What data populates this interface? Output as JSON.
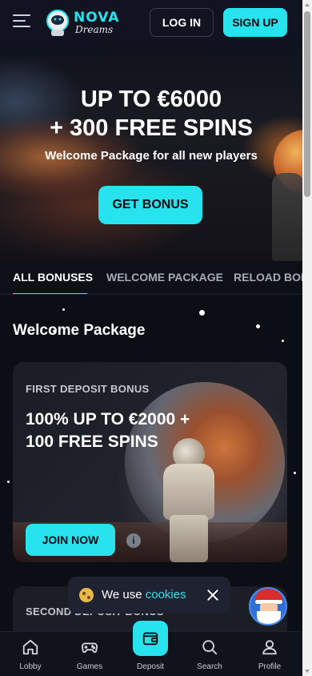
{
  "header": {
    "login_label": "LOG IN",
    "signup_label": "SIGN UP",
    "logo_main": "NOVA",
    "logo_sub": "Dreams"
  },
  "hero": {
    "title_line1": "UP TO €6000",
    "title_line2": "+ 300 FREE SPINS",
    "subtitle": "Welcome Package for all new players",
    "cta_label": "GET BONUS"
  },
  "tabs": [
    {
      "label": "ALL BONUSES",
      "active": true
    },
    {
      "label": "WELCOME PACKAGE",
      "active": false
    },
    {
      "label": "RELOAD BONUSES",
      "active": false
    }
  ],
  "section": {
    "title": "Welcome Package"
  },
  "cards": [
    {
      "label": "FIRST DEPOSIT BONUS",
      "offer": "100% UP TO €2000 + 100 FREE SPINS",
      "cta_label": "JOIN NOW",
      "info_symbol": "i"
    },
    {
      "label": "SECOND DEPOSIT BONUS"
    }
  ],
  "cookie": {
    "text": "We use ",
    "link_label": "cookies"
  },
  "bottom_nav": [
    {
      "label": "Lobby",
      "icon": "home-icon"
    },
    {
      "label": "Games",
      "icon": "gamepad-icon"
    },
    {
      "label": "Deposit",
      "icon": "wallet-icon"
    },
    {
      "label": "Search",
      "icon": "search-icon"
    },
    {
      "label": "Profile",
      "icon": "user-icon"
    }
  ],
  "colors": {
    "accent": "#26e3ee",
    "background": "#0c0e15",
    "header": "#111420"
  }
}
